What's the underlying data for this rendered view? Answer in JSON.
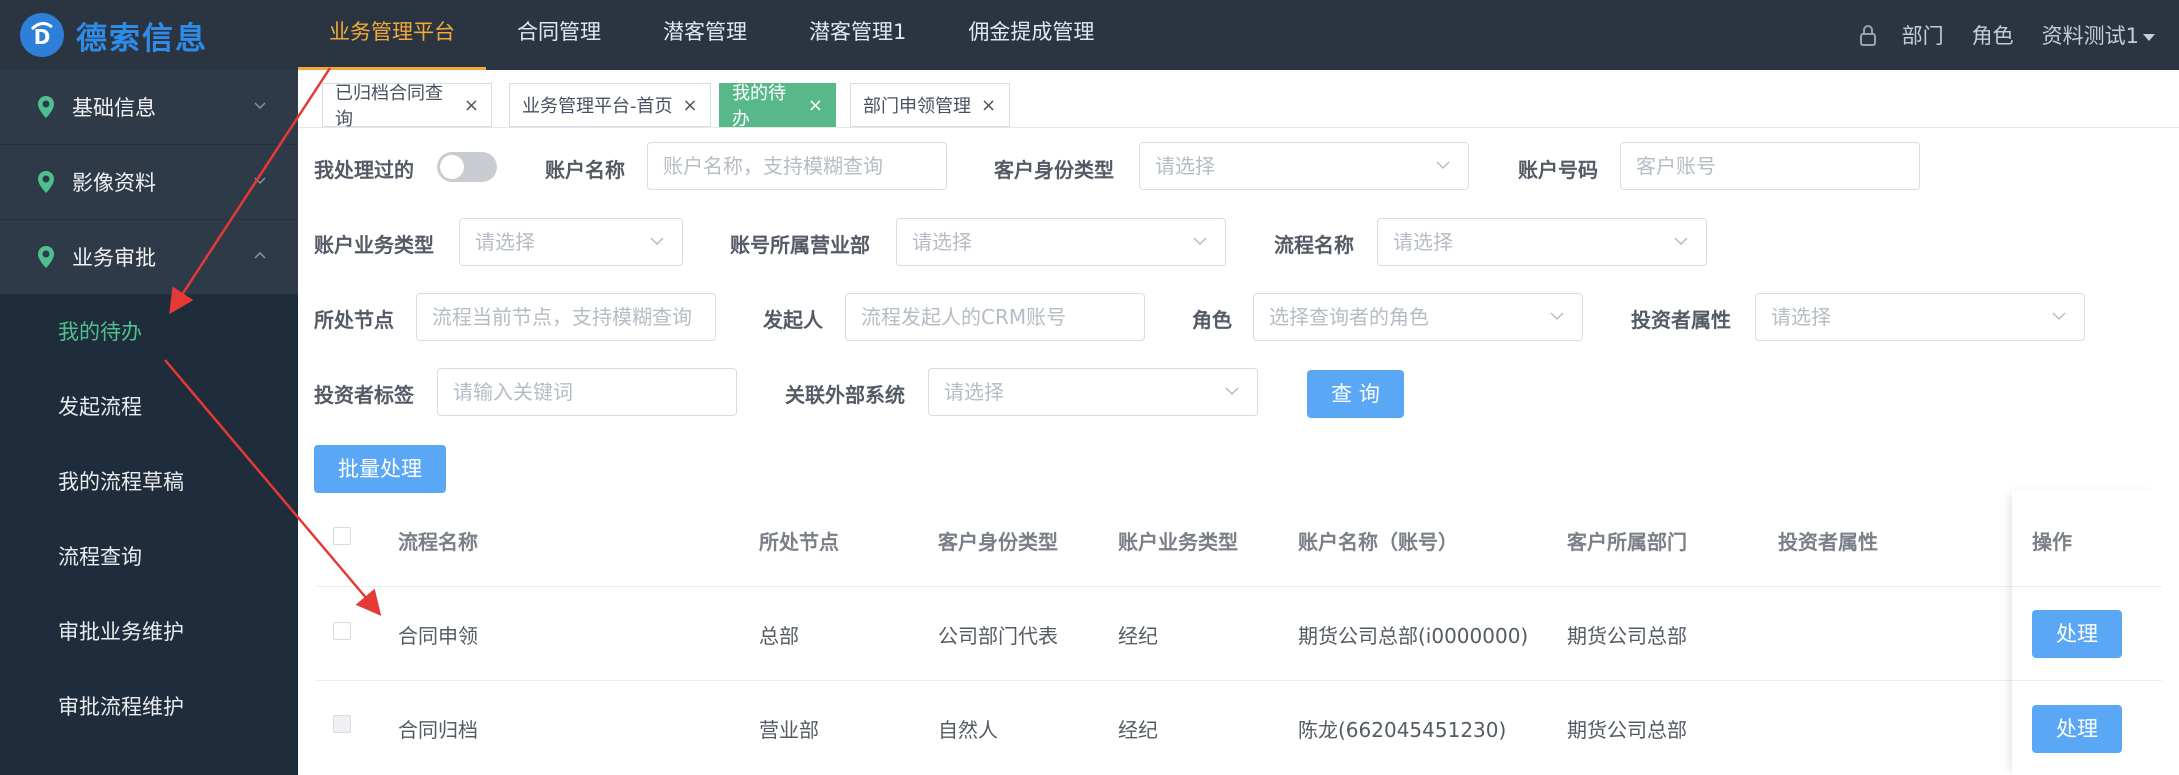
{
  "brand": {
    "name": "德索信息",
    "logo_letter": "D"
  },
  "top_nav": [
    {
      "label": "业务管理平台",
      "active": true
    },
    {
      "label": "合同管理"
    },
    {
      "label": "潜客管理"
    },
    {
      "label": "潜客管理1"
    },
    {
      "label": "佣金提成管理"
    }
  ],
  "top_right": {
    "dept": "部门",
    "role": "角色",
    "user": "资料测试1"
  },
  "sidebar": {
    "groups": [
      {
        "label": "基础信息",
        "expanded": false
      },
      {
        "label": "影像资料",
        "expanded": false
      },
      {
        "label": "业务审批",
        "expanded": true
      }
    ],
    "sub_items": [
      {
        "label": "我的待办",
        "active": true
      },
      {
        "label": "发起流程"
      },
      {
        "label": "我的流程草稿"
      },
      {
        "label": "流程查询"
      },
      {
        "label": "审批业务维护"
      },
      {
        "label": "审批流程维护"
      }
    ]
  },
  "tabs": [
    {
      "label": "已归档合同查询",
      "close": "×"
    },
    {
      "label": "业务管理平台-首页",
      "close": "×"
    },
    {
      "label": "我的待办",
      "close": "×",
      "active": true
    },
    {
      "label": "部门申领管理",
      "close": "×"
    }
  ],
  "filters": {
    "handled": {
      "label": "我处理过的",
      "on": false
    },
    "account_name": {
      "label": "账户名称",
      "placeholder": "账户名称，支持模糊查询"
    },
    "client_id_type": {
      "label": "客户身份类型",
      "placeholder": "请选择"
    },
    "account_no": {
      "label": "账户号码",
      "placeholder": "客户账号"
    },
    "biz_type": {
      "label": "账户业务类型",
      "placeholder": "请选择"
    },
    "branch": {
      "label": "账号所属营业部",
      "placeholder": "请选择"
    },
    "flow_name": {
      "label": "流程名称",
      "placeholder": "请选择"
    },
    "node": {
      "label": "所处节点",
      "placeholder": "流程当前节点，支持模糊查询"
    },
    "initiator": {
      "label": "发起人",
      "placeholder": "流程发起人的CRM账号"
    },
    "role": {
      "label": "角色",
      "placeholder": "选择查询者的角色"
    },
    "investor_attr": {
      "label": "投资者属性",
      "placeholder": "请选择"
    },
    "investor_tag": {
      "label": "投资者标签",
      "placeholder": "请输入关键词"
    },
    "ext_system": {
      "label": "关联外部系统",
      "placeholder": "请选择"
    },
    "query_button": "查 询"
  },
  "batch_button": "批量处理",
  "table": {
    "columns": [
      "流程名称",
      "所处节点",
      "客户身份类型",
      "账户业务类型",
      "账户名称（账号）",
      "客户所属部门",
      "投资者属性",
      "操作"
    ],
    "rows": [
      {
        "flow": "合同申领",
        "node": "总部",
        "id_type": "公司部门代表",
        "biz_type": "经纪",
        "account": "期货公司总部(i0000000)",
        "dept": "期货公司总部",
        "investor": "",
        "action": "处理"
      },
      {
        "flow": "合同归档",
        "node": "营业部",
        "id_type": "自然人",
        "biz_type": "经纪",
        "account": "陈龙(662045451230)",
        "dept": "期货公司总部",
        "investor": "",
        "action": "处理"
      }
    ]
  },
  "colors": {
    "topbar": "#2b3441",
    "sidebar": "#1f2c3b",
    "accent": "#f2a93b",
    "active_green": "#4fc08d",
    "primary": "#5aa7f6",
    "annotation": "#e53935"
  }
}
